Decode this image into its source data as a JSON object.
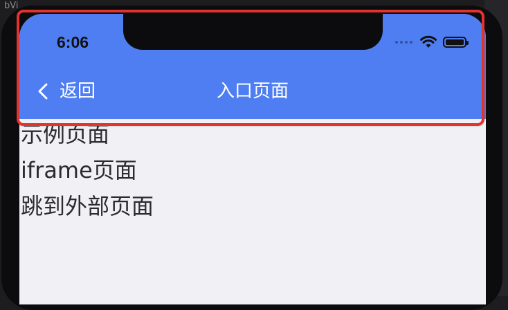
{
  "background": {
    "corner_text": "bVi"
  },
  "status_bar": {
    "time": "6:06"
  },
  "nav_bar": {
    "back_label": "返回",
    "title": "入口页面",
    "color": "#4f7ef2"
  },
  "list": {
    "items": [
      {
        "label": "示例页面"
      },
      {
        "label": "iframe页面"
      },
      {
        "label": "跳到外部页面"
      }
    ]
  },
  "annotation": {
    "highlight_color": "#e3332d"
  }
}
